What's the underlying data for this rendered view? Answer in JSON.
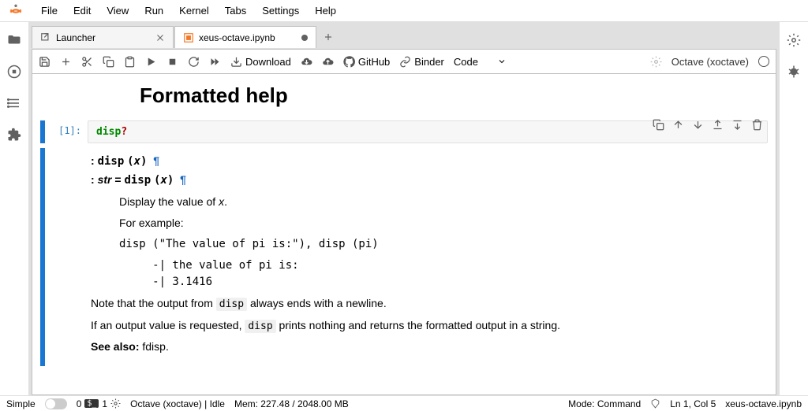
{
  "menu": {
    "items": [
      "File",
      "Edit",
      "View",
      "Run",
      "Kernel",
      "Tabs",
      "Settings",
      "Help"
    ]
  },
  "tabs": {
    "launcher": "Launcher",
    "notebook": "xeus-octave.ipynb"
  },
  "toolbar": {
    "download": "Download",
    "github": "GitHub",
    "binder": "Binder",
    "celltype": "Code",
    "kernel": "Octave (xoctave)"
  },
  "notebook": {
    "title": "Formatted help",
    "prompt": "[1]:",
    "code_fn": "disp",
    "code_op": "?",
    "sig1_disp": "disp",
    "sig1_var": "x",
    "sig2_str": "str",
    "sig2_eq": "=",
    "sig2_disp": "disp",
    "sig2_var": "x",
    "doc_p1a": "Display the value of ",
    "doc_p1b": "x",
    "doc_p1c": ".",
    "doc_p2": "For example:",
    "doc_code1": "disp (\"The value of pi is:\"), disp (pi)",
    "doc_out": "     -| the value of pi is:\n     -| 3.1416",
    "doc_p3a": "Note that the output from ",
    "doc_p3b": "disp",
    "doc_p3c": " always ends with a newline.",
    "doc_p4a": "If an output value is requested, ",
    "doc_p4b": "disp",
    "doc_p4c": " prints nothing and returns the formatted output in a string.",
    "doc_see": "See also:",
    "doc_see_link": " fdisp."
  },
  "status": {
    "simple": "Simple",
    "tabs_count": "0",
    "terminals_count": "1",
    "kernel": "Octave (xoctave) | Idle",
    "mem": "Mem: 227.48 / 2048.00 MB",
    "mode": "Mode: Command",
    "cursor": "Ln 1, Col 5",
    "filename": "xeus-octave.ipynb"
  }
}
